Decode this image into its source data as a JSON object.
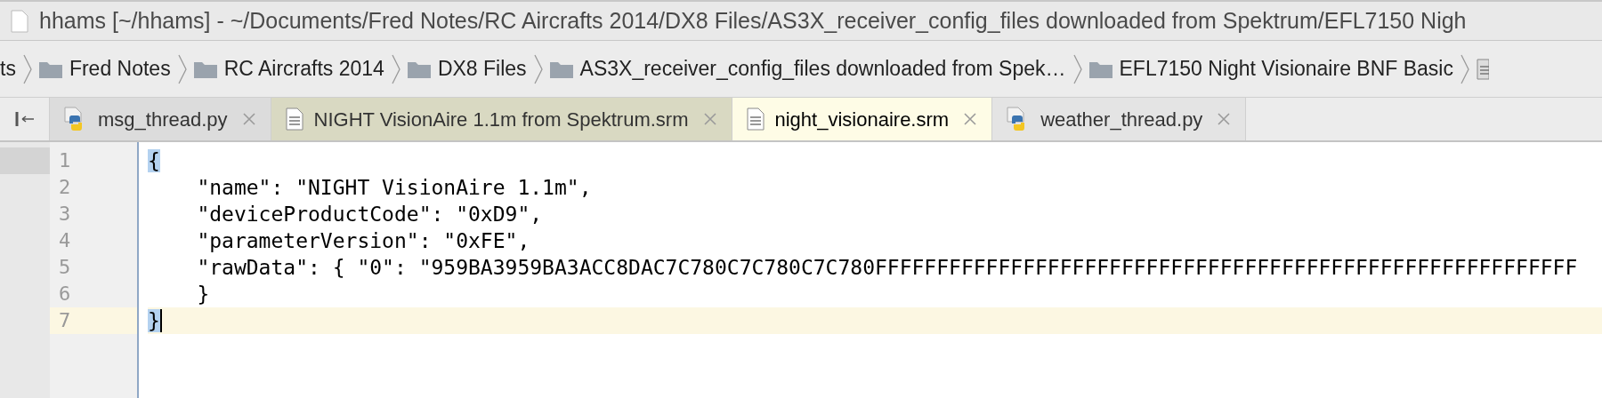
{
  "window": {
    "title": "hhams [~/hhams] - ~/Documents/Fred Notes/RC Aircrafts 2014/DX8 Files/AS3X_receiver_config_files downloaded from Spektrum/EFL7150 Nigh"
  },
  "breadcrumbs": [
    {
      "label": "ts",
      "kind": "text"
    },
    {
      "label": "Fred Notes",
      "kind": "folder"
    },
    {
      "label": "RC Aircrafts 2014",
      "kind": "folder"
    },
    {
      "label": "DX8 Files",
      "kind": "folder"
    },
    {
      "label": "AS3X_receiver_config_files downloaded from Spek…",
      "kind": "folder"
    },
    {
      "label": "EFL7150 Night Visionaire BNF Basic",
      "kind": "folder"
    }
  ],
  "tabs": [
    {
      "label": "msg_thread.py",
      "kind": "python",
      "selected": false,
      "color": "#dcdcdc"
    },
    {
      "label": "NIGHT VisionAire 1.1m from Spektrum.srm",
      "kind": "text",
      "selected": false,
      "color": "#d9d9c2"
    },
    {
      "label": "night_visionaire.srm",
      "kind": "text",
      "selected": true,
      "color": "#fefce6"
    },
    {
      "label": "weather_thread.py",
      "kind": "python",
      "selected": false,
      "color": "#e4e4e4"
    }
  ],
  "editor": {
    "lines": [
      {
        "number": "1",
        "text": "{",
        "current": false,
        "brace_match": true
      },
      {
        "number": "2",
        "text": "    \"name\": \"NIGHT VisionAire 1.1m\",",
        "current": false,
        "brace_match": false
      },
      {
        "number": "3",
        "text": "    \"deviceProductCode\": \"0xD9\",",
        "current": false,
        "brace_match": false
      },
      {
        "number": "4",
        "text": "    \"parameterVersion\": \"0xFE\",",
        "current": false,
        "brace_match": false
      },
      {
        "number": "5",
        "text": "    \"rawData\": { \"0\": \"959BA3959BA3ACC8DAC7C780C7C780C7C780FFFFFFFFFFFFFFFFFFFFFFFFFFFFFFFFFFFFFFFFFFFFFFFFFFFFFFFFF",
        "current": false,
        "brace_match": false
      },
      {
        "number": "6",
        "text": "    }",
        "current": false,
        "brace_match": false
      },
      {
        "number": "7",
        "text": "}",
        "current": true,
        "brace_match": true
      }
    ]
  }
}
